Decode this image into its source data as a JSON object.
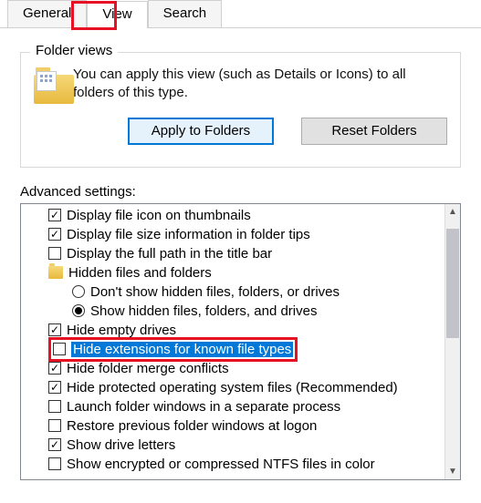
{
  "tabs": {
    "general": "General",
    "view": "View",
    "search": "Search"
  },
  "groupbox": {
    "title": "Folder views",
    "desc": "You can apply this view (such as Details or Icons) to all folders of this type.",
    "apply": "Apply to Folders",
    "reset": "Reset Folders"
  },
  "adv_label": "Advanced settings:",
  "items": [
    {
      "type": "check",
      "checked": true,
      "text": "Display file icon on thumbnails"
    },
    {
      "type": "check",
      "checked": true,
      "text": "Display file size information in folder tips"
    },
    {
      "type": "check",
      "checked": false,
      "text": "Display the full path in the title bar"
    },
    {
      "type": "folder",
      "text": "Hidden files and folders"
    },
    {
      "type": "radio",
      "checked": false,
      "text": "Don't show hidden files, folders, or drives"
    },
    {
      "type": "radio",
      "checked": true,
      "text": "Show hidden files, folders, and drives"
    },
    {
      "type": "check",
      "checked": true,
      "text": "Hide empty drives"
    },
    {
      "type": "check",
      "checked": false,
      "text": "Hide extensions for known file types",
      "highlighted": true
    },
    {
      "type": "check",
      "checked": true,
      "text": "Hide folder merge conflicts"
    },
    {
      "type": "check",
      "checked": true,
      "text": "Hide protected operating system files (Recommended)"
    },
    {
      "type": "check",
      "checked": false,
      "text": "Launch folder windows in a separate process"
    },
    {
      "type": "check",
      "checked": false,
      "text": "Restore previous folder windows at logon"
    },
    {
      "type": "check",
      "checked": true,
      "text": "Show drive letters"
    },
    {
      "type": "check",
      "checked": false,
      "text": "Show encrypted or compressed NTFS files in color"
    }
  ]
}
